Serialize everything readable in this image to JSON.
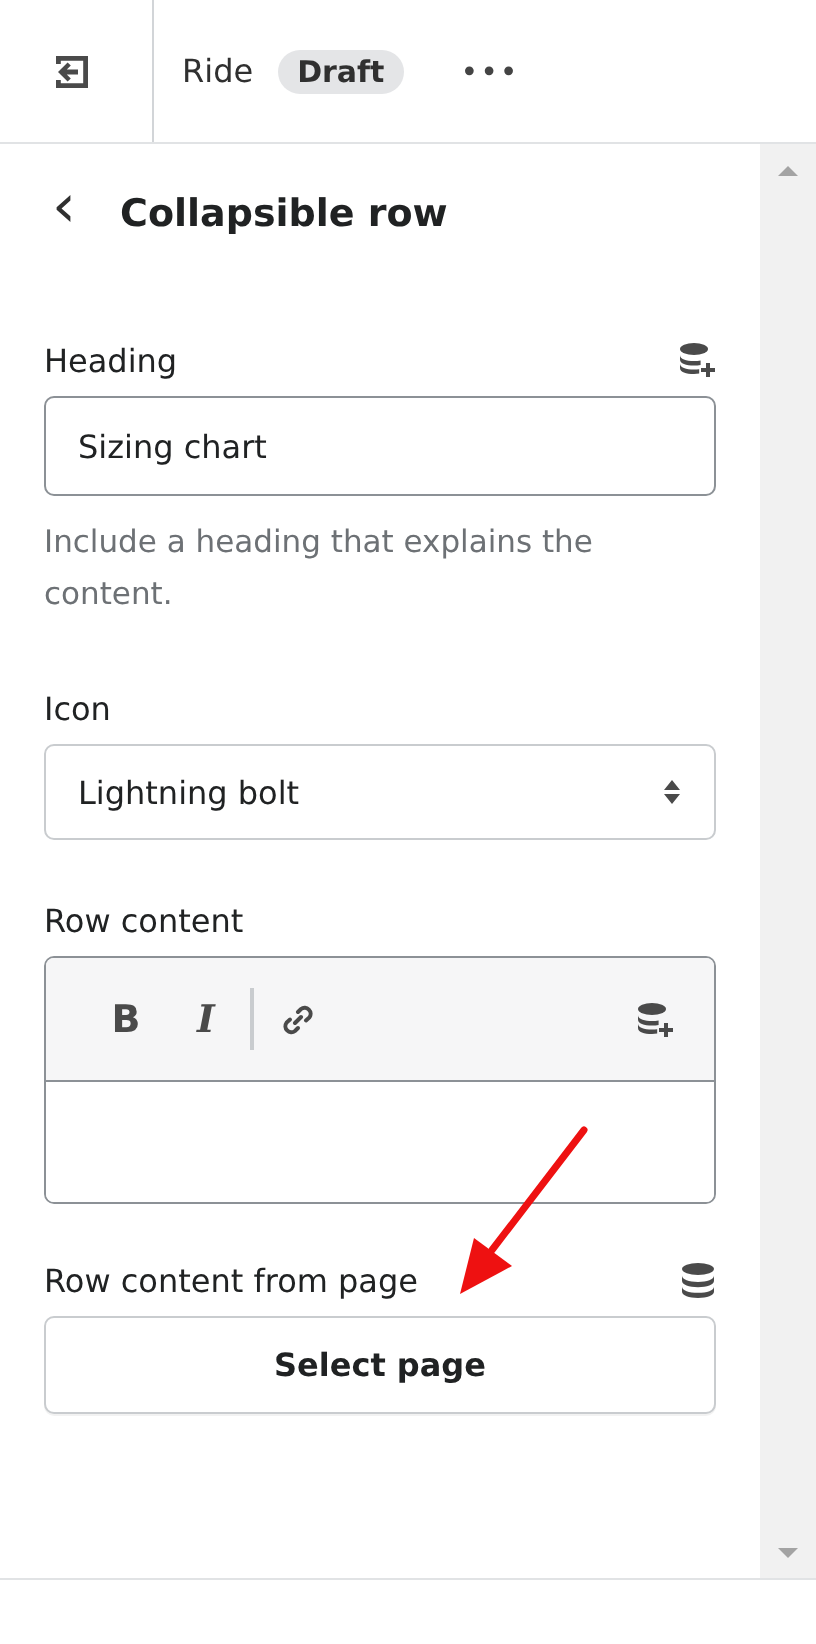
{
  "top_bar": {
    "title": "Ride",
    "status_badge": "Draft",
    "more_menu": "•••"
  },
  "panel": {
    "back": "‹",
    "title": "Collapsible row"
  },
  "fields": [
    {
      "kind": "text",
      "label": "Heading",
      "value": "Sizing chart",
      "help": "Include a heading that explains the content."
    },
    {
      "kind": "select",
      "label": "Icon",
      "value": "Lightning bolt"
    },
    {
      "kind": "richtext",
      "label": "Row content",
      "toolbar": [
        "B",
        "I"
      ]
    },
    {
      "kind": "picker",
      "label": "Row content from page",
      "button": "Select page"
    }
  ]
}
